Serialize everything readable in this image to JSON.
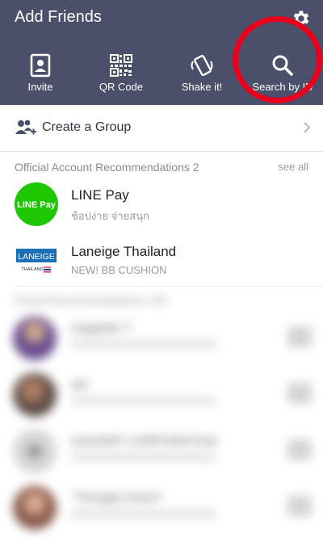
{
  "header": {
    "title": "Add Friends",
    "settings_icon": "gear-icon",
    "background_color": "#4a506a"
  },
  "actions": [
    {
      "label": "Invite",
      "icon": "invite-icon"
    },
    {
      "label": "QR Code",
      "icon": "qr-code-icon"
    },
    {
      "label": "Shake it!",
      "icon": "shake-phone-icon"
    },
    {
      "label": "Search by ID",
      "icon": "search-icon"
    }
  ],
  "highlight_color": "#e8001c",
  "create_group": {
    "label": "Create a Group",
    "icon": "add-group-icon"
  },
  "official_accounts": {
    "heading": "Official Account Recommendations 2",
    "see_all": "see all",
    "items": [
      {
        "name": "LINE Pay",
        "subtitle": "ช้อปง่าย จ่ายสนุก",
        "logo_text": "LINE Pay",
        "logo_color": "#1ec800"
      },
      {
        "name": "Laneige Thailand",
        "subtitle": "NEW! BB CUSHION",
        "logo_text": "LANEIGE",
        "logo_subtext": "THAILAND",
        "logo_color": "#1a6fb5"
      }
    ]
  },
  "friend_recommendations": {
    "heading": "Friend Recommendations 159",
    "items": [
      {
        "name": "Gaganbir T"
      },
      {
        "name": "ark"
      },
      {
        "name": "GAZAMIT CORPORATION"
      },
      {
        "name": "\"Thongbo Dsorn\""
      }
    ]
  }
}
